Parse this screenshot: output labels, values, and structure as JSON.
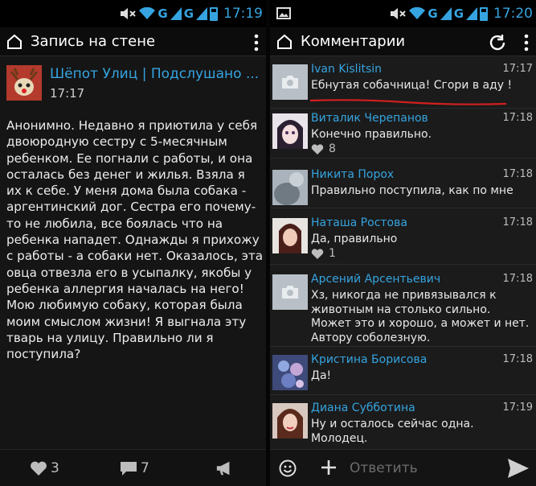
{
  "status_left": {
    "time": "17:19",
    "net1": "G",
    "net2": "G"
  },
  "status_right": {
    "time": "17:20",
    "net1": "G",
    "net2": "G"
  },
  "left_appbar": {
    "title": "Запись на стене"
  },
  "right_appbar": {
    "title": "Комментарии"
  },
  "post": {
    "author": "Шёпот Улиц | Подслушано ...",
    "time": "17:17",
    "text": "Анонимно. Недавно я приютила у себя двоюродную сестру с 5-месячным ребенком. Ее погнали с работы, и она осталась без денег и жилья. Взяла я их к себе. У меня дома была собака - аргентинский дог. Сестра его почему-то не любила, все боялась что на ребенка нападет. Однажды я прихожу с работы - а собаки нет. Оказалось, эта овца отвезла его в усыпалку, якобы у ребенка аллергия началась на него! Мою любимую собаку, которая была моим смыслом жизни! Я выгнала эту тварь на улицу. Правильно ли я поступила?",
    "likes": "3",
    "comments": "7"
  },
  "comments": [
    {
      "name": "Ivan Kislitsin",
      "time": "17:17",
      "text": "Ебнутая собачница! Сгори в аду !",
      "likes": ""
    },
    {
      "name": "Виталик Черепанов",
      "time": "17:18",
      "text": "Конечно правильно.",
      "likes": "8"
    },
    {
      "name": "Никита Порох",
      "time": "17:18",
      "text": "Правильно поступила, как по мне",
      "likes": ""
    },
    {
      "name": "Наташа Ростова",
      "time": "17:18",
      "text": "Да, правильно",
      "likes": "1"
    },
    {
      "name": "Арсений Арсентьевич",
      "time": "17:18",
      "text": "Хз, никогда не привязывался к животным на столько сильно. Может это и хорошо, а может и нет. Автору соболезную.",
      "likes": ""
    },
    {
      "name": "Кристина Борисова",
      "time": "17:18",
      "text": "Да!",
      "likes": ""
    },
    {
      "name": "Диана Субботина",
      "time": "17:19",
      "text": "Ну и осталось сейчас одна. Молодец.",
      "likes": ""
    }
  ],
  "reply": {
    "placeholder": "Ответить"
  },
  "colors": {
    "accent": "#35a4e0",
    "annotation": "#d21f1f"
  },
  "icons": [
    "mute-icon",
    "wifi-icon",
    "signal-icon",
    "battery-icon",
    "gallery-icon",
    "home-icon",
    "overflow-icon",
    "refresh-icon",
    "heart-icon",
    "comment-icon",
    "megaphone-icon",
    "camera-placeholder-icon",
    "emoji-icon",
    "plus-icon",
    "send-icon"
  ]
}
